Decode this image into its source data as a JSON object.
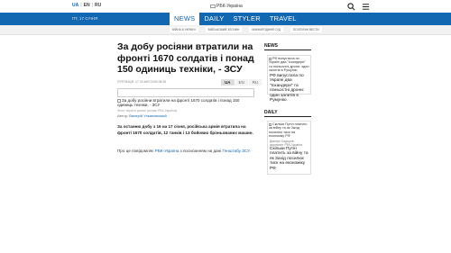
{
  "header": {
    "langs": [
      "UA",
      "EN",
      "RU"
    ],
    "logo_text": "РБК-Україна"
  },
  "nav": {
    "date": "ПТ, 17 СІЧНЯ",
    "tabs": [
      "NEWS",
      "DAILY",
      "STYLER",
      "TRAVEL"
    ],
    "active_tab": "NEWS"
  },
  "tags": [
    "ВІЙНА В УКРАЇНІ",
    "ВІЙСЬКОВИЙ ЗЛОЧИН",
    "МІЖНАРОДНИЙ СУД",
    "ПОЛІТИЧНІ ВЕСТИ"
  ],
  "article": {
    "title": "За добу росіяни втратили на фронті 1670 солдатів і понад 150 одиниць техніки, - ЗСУ",
    "meta": "П'ЯТНИЦЯ, 17 СІЧНЯ 2025 08:35",
    "lang_switch": [
      "UA",
      "EN",
      "RU"
    ],
    "active_lang": "UA",
    "image_caption": "За добу росіяни втратили на фронті 1670 солдатів і понад 150 одиниць техніки, - ЗСУ",
    "image_credit": "Фото: втрати росіян (колаж РБК-Україна)",
    "author_label": "Автор:",
    "author_name": "Валерій Ульяновський",
    "lead": "За останню добу з 16 на 17 січня, російська армія втратила на фронті 1670 солдатів, 12 танків і 13 бойових броньованих машин.",
    "para_prefix": "Про це повідомляє ",
    "para_link": "РБК-Україна",
    "para_middle": " з посиланням на дані ",
    "para_link2": "Генштабу ЗСУ",
    "para_suffix": "."
  },
  "sidebar": {
    "news_title": "NEWS",
    "news_card": {
      "image_alt": "РФ випустила по Україні два \"Іскандери\" та пізньостні дрони: один залетів в Румунію",
      "title": "РФ випустила по Україні два \"Іскандери\" та пізньостні дрони: один залетів в Румунію"
    },
    "daily_title": "DAILY",
    "daily_card": {
      "image_alt": "Скільки Путін платить за війну та як Захід посилює тиск на економіку РФ",
      "author": "Дмитро Сидоров",
      "author_role": "журналіст РБК-Україна",
      "title": "Скільки Путін платить за війну та як Захід посилює тиск на економіку РФ"
    }
  }
}
